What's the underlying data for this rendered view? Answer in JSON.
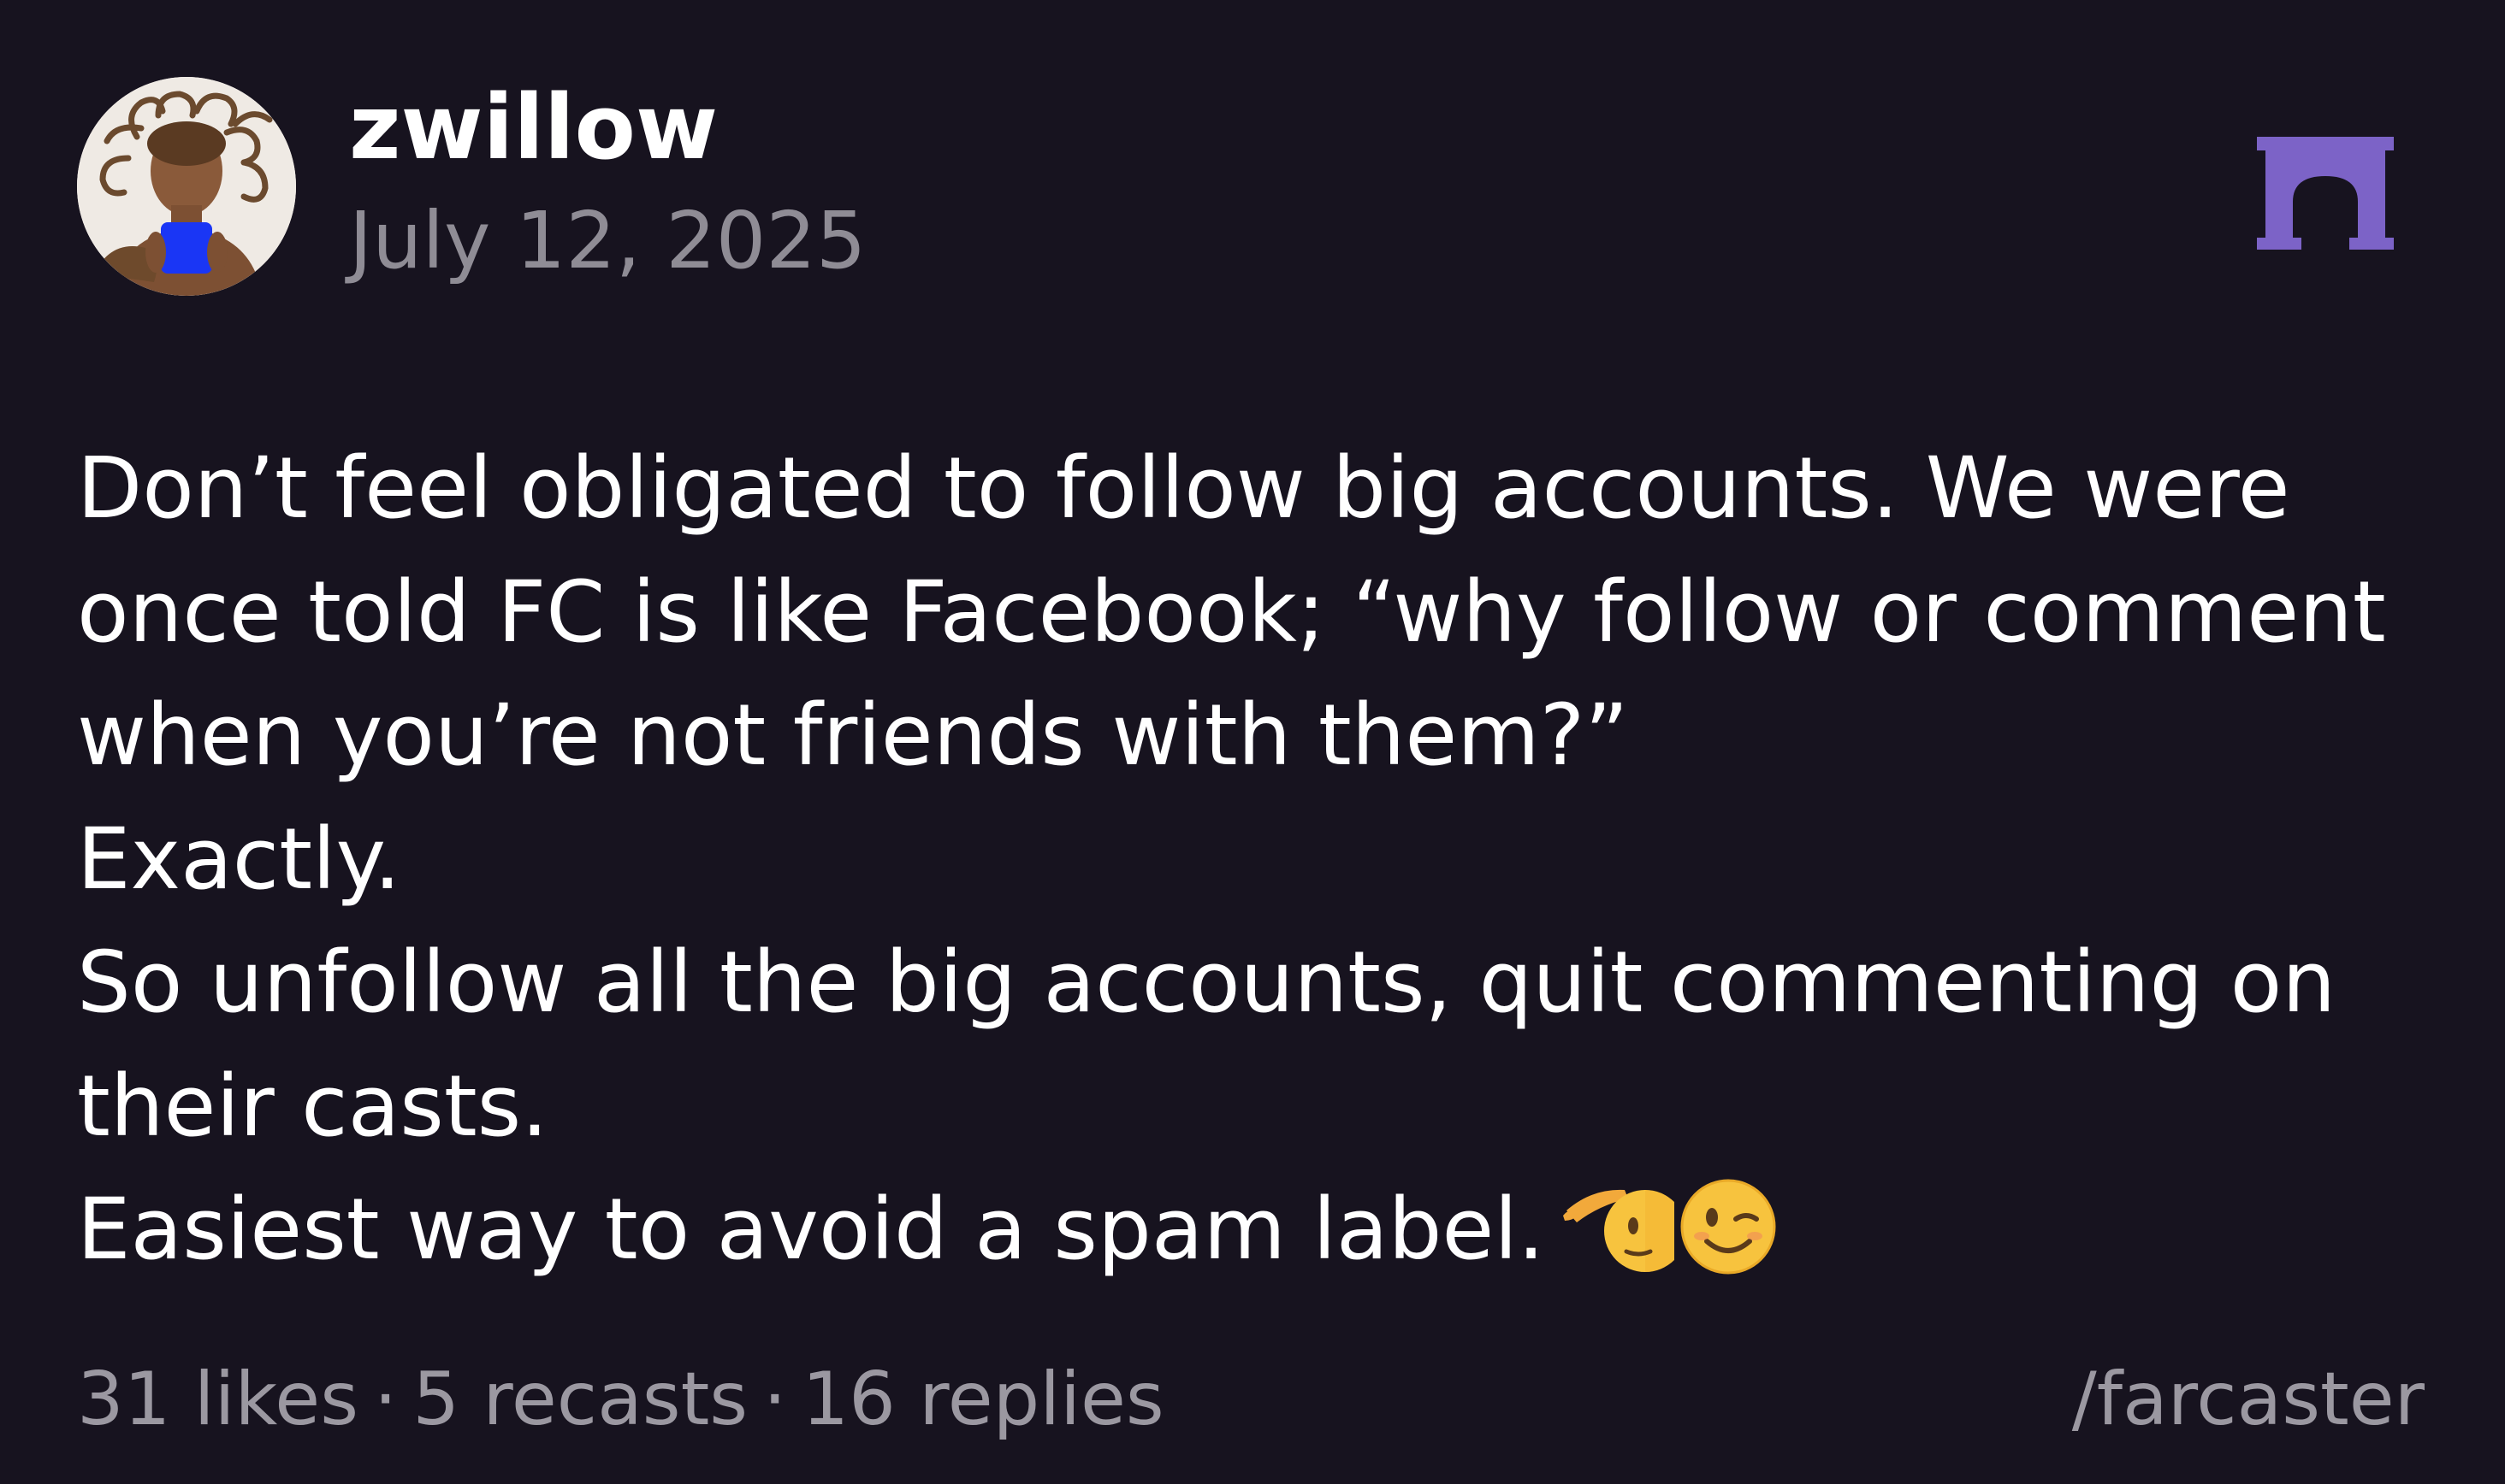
{
  "post": {
    "author": {
      "username": "zwillow"
    },
    "date": "July 12, 2025",
    "text_lines": [
      "Don’t feel obligated to follow big accounts. We were",
      "once told FC is like Facebook; “why follow or comment",
      "when you’re not friends with them?”",
      "Exactly.",
      "So unfollow all the big accounts, quit commenting on",
      "their casts.",
      "Easiest way to avoid a spam label."
    ],
    "emojis": [
      "saluting-face-icon",
      "winking-face-icon"
    ],
    "stats": {
      "likes": "31 likes",
      "recasts": "5 recasts",
      "replies": "16 replies",
      "separator": "·"
    },
    "channel": "/farcaster"
  },
  "colors": {
    "background": "#17131f",
    "text": "#ffffff",
    "muted": "#8f8c95",
    "brand": "#7c63c7"
  },
  "icons": {
    "logo": "farcaster-arch-icon"
  }
}
